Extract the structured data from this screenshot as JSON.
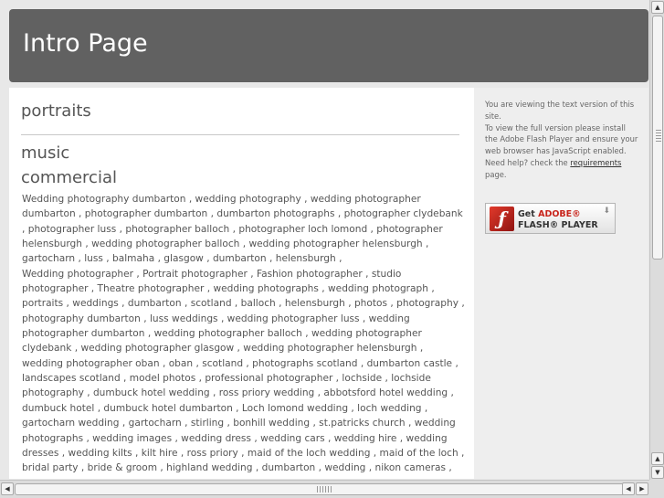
{
  "header": {
    "title": "Intro Page"
  },
  "content": {
    "headings": [
      "portraits",
      "music",
      "commercial"
    ],
    "keyword_paragraphs": [
      "Wedding photography dumbarton , wedding photography , wedding photographer dumbarton , photographer dumbarton , dumbarton photographs , photographer clydebank , photographer luss , photographer balloch , photographer loch lomond , photographer helensburgh , wedding photographer balloch , wedding photographer helensburgh , gartocharn , luss , balmaha , glasgow , dumbarton , helensburgh ,",
      "Wedding photographer , Portrait photographer , Fashion photographer , studio photographer , Theatre photographer , wedding photographs , wedding photograph , portraits , weddings , dumbarton , scotland , balloch , helensburgh , photos , photography , photography dumbarton , luss weddings , wedding photographer luss , wedding photographer dumbarton , wedding photographer balloch , wedding photographer clydebank , wedding photographer glasgow , wedding photographer helensburgh , wedding photographer oban , oban , scotland , photographs scotland , dumbarton castle , landscapes scotland , model photos , professional photographer , lochside , lochside photography , dumbuck hotel wedding , ross priory wedding , abbotsford hotel wedding , dumbuck hotel , dumbuck hotel dumbarton , Loch lomond wedding , loch wedding , gartocharn wedding , gartocharn , stirling , bonhill wedding , st.patricks church , wedding photographs , wedding images , wedding dress , wedding cars , wedding hire , wedding dresses , wedding kilts , kilt hire , ross priory , maid of the loch wedding , maid of the loch , bridal party , bride & groom , highland wedding , dumbarton , wedding , nikon cameras , nikon , nikon camera , foto , photo optix , jacobs , jessops , jessops cameras , mummers theatre group ,"
    ]
  },
  "sidebar": {
    "line1": "You are viewing the text version of this site.",
    "line2": "To view the full version please install the Adobe Flash Player and ensure your web browser has JavaScript enabled.",
    "help_prefix": "Need help? check the ",
    "help_link": "requirements",
    "help_suffix": "page.",
    "flash_badge": {
      "get_text": "Get",
      "adobe_text": "ADOBE®",
      "product_text": "FLASH® PLAYER",
      "logo_icon": "flash-logo-icon",
      "colors": {
        "logo": "#c8241b"
      }
    }
  },
  "scrollbars": {
    "vertical_position_fraction": 0.0,
    "horizontal_position_fraction": 0.0
  },
  "colors": {
    "header_bg": "#616161",
    "page_bg": "#e8e8e8",
    "sidebar_bg": "#eeeeee"
  }
}
